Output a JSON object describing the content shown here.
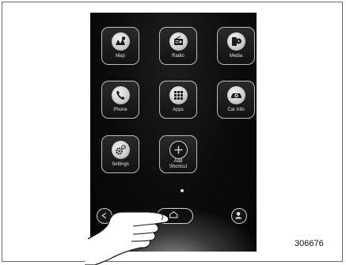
{
  "apps": [
    {
      "label": "Map",
      "icon": "map-icon"
    },
    {
      "label": "Radio",
      "icon": "radio-icon"
    },
    {
      "label": "Media",
      "icon": "media-icon"
    },
    {
      "label": "Phone",
      "icon": "phone-icon"
    },
    {
      "label": "Apps",
      "icon": "apps-grid-icon"
    },
    {
      "label": "Car Info",
      "icon": "car-info-icon"
    },
    {
      "label": "Settings",
      "icon": "gears-icon"
    }
  ],
  "add_shortcut": {
    "line1": "Add",
    "line2": "Shortcut",
    "icon": "plus-circle-icon"
  },
  "bottom_bar": {
    "left_button_icon": "back-arrow-icon",
    "home_button_icon": "home-icon",
    "right_button_icon": "user-profile-icon"
  },
  "figure_number": "306676",
  "colors": {
    "screen_background": "#0b0b0b",
    "tile_border": "#bcbcbc",
    "icon_fill": "#d9d9d9",
    "label_text": "#e8e8e8"
  }
}
